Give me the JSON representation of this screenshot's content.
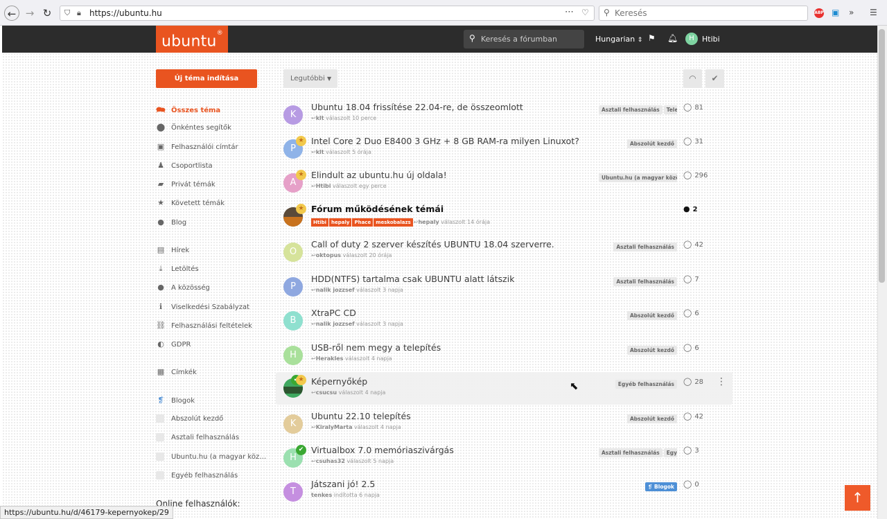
{
  "browser": {
    "url": "https://ubuntu.hu",
    "search_placeholder": "Keresés",
    "status_url": "https://ubuntu.hu/d/46179-kepernyokep/29"
  },
  "header": {
    "logo_text": "ubuntu",
    "logo_mark": "®",
    "search_placeholder": "Keresés a fórumban",
    "language": "Hungarian",
    "username": "Htibi",
    "avatar_letter": "H"
  },
  "sidebar": {
    "new_topic": "Új téma indítása",
    "items": [
      {
        "label": "Összes téma",
        "icon": "💬"
      },
      {
        "label": "Önkéntes segítők",
        "icon": "📍"
      },
      {
        "label": "Felhasználói címtár",
        "icon": "▣"
      },
      {
        "label": "Csoportlista",
        "icon": "👥"
      },
      {
        "label": "Privát témák",
        "icon": "🗨"
      },
      {
        "label": "Követett témák",
        "icon": "★"
      },
      {
        "label": "Blog",
        "icon": "●"
      },
      {
        "label": "Hírek",
        "icon": "▤"
      },
      {
        "label": "Letöltés",
        "icon": "⤓"
      },
      {
        "label": "A közösség",
        "icon": "●"
      },
      {
        "label": "Viselkedési Szabályzat",
        "icon": "ℹ"
      },
      {
        "label": "Felhasználási feltételek",
        "icon": "🔗"
      },
      {
        "label": "GDPR",
        "icon": "◐"
      },
      {
        "label": "Címkék",
        "icon": "▦"
      },
      {
        "label": "Blogok",
        "icon": "❡"
      },
      {
        "label": "Abszolút kezdő",
        "icon": ""
      },
      {
        "label": "Asztali felhasználás",
        "icon": ""
      },
      {
        "label": "Ubuntu.hu (a magyar köz…",
        "icon": ""
      },
      {
        "label": "Egyéb felhasználás",
        "icon": ""
      }
    ],
    "online_label": "Online felhasználók:"
  },
  "toolbar": {
    "sort_label": "Legutóbbi"
  },
  "topics": [
    {
      "title": "Ubuntu 18.04 frissítése 22.04-re, de összeomlott",
      "user": "klt",
      "meta": "válaszolt 10 perce",
      "tags": [
        "Asztali felhasználás",
        "Telepít"
      ],
      "count": "81",
      "avatar": "K",
      "color": "#b79be3"
    },
    {
      "title": "Intel Core 2 Duo E8400 3 GHz + 8 GB RAM-ra milyen Linuxot?",
      "user": "klt",
      "meta": "válaszolt 5 órája",
      "tags": [
        "Abszolút kezdő"
      ],
      "count": "31",
      "avatar": "P",
      "color": "#8fb3e8"
    },
    {
      "title": "Elindult az ubuntu.hu új oldala!",
      "user": "Htibi",
      "meta": "válaszolt egy perce",
      "tags": [
        "Ubuntu.hu (a magyar közösség"
      ],
      "count": "296",
      "avatar": "A",
      "color": "#e6a0c8"
    },
    {
      "title": "Fórum működésének témái",
      "user": "hepaly",
      "meta": "válaszolt 14 órája",
      "user_tags": [
        "Htibi",
        "hepaly",
        "Phace",
        "meskobalazs"
      ],
      "tags": [],
      "count": "2",
      "avatar": "",
      "color": "#5a4a3a"
    },
    {
      "title": "Call of duty 2 szerver készítés UBUNTU 18.04 szerverre.",
      "user": "oktopus",
      "meta": "válaszolt 20 órája",
      "tags": [
        "Asztali felhasználás"
      ],
      "count": "42",
      "avatar": "O",
      "color": "#d6e39b"
    },
    {
      "title": "HDD(NTFS) tartalma csak UBUNTU alatt látszik",
      "user": "nalik jozzsef",
      "meta": "válaszolt 3 napja",
      "tags": [
        "Asztali felhasználás"
      ],
      "count": "7",
      "avatar": "P",
      "color": "#8fa8e0"
    },
    {
      "title": "XtraPC CD",
      "user": "nalik jozzsef",
      "meta": "válaszolt 3 napja",
      "tags": [
        "Abszolút kezdő"
      ],
      "count": "6",
      "avatar": "B",
      "color": "#8fe0cf"
    },
    {
      "title": "USB-ről nem megy a telepítés",
      "user": "Herakles",
      "meta": "válaszolt 4 napja",
      "tags": [
        "Abszolút kezdő"
      ],
      "count": "6",
      "avatar": "H",
      "color": "#a9e09b"
    },
    {
      "title": "Képernyőkép",
      "user": "csucsu",
      "meta": "válaszolt 4 napja",
      "tags": [
        "Egyéb felhasználás"
      ],
      "count": "28",
      "avatar": "",
      "color": "#3fa860"
    },
    {
      "title": "Ubuntu 22.10 telepítés",
      "user": "KiralyMarta",
      "meta": "válaszolt 4 napja",
      "tags": [
        "Abszolút kezdő"
      ],
      "count": "42",
      "avatar": "K",
      "color": "#e3cc9b"
    },
    {
      "title": "Virtualbox 7.0 memóriaszivárgás",
      "user": "csuhas32",
      "meta": "válaszolt 5 napja",
      "tags": [
        "Asztali felhasználás",
        "Egyéb f"
      ],
      "count": "3",
      "avatar": "H",
      "color": "#9be0b0"
    },
    {
      "title": "Játszani jó! 2.5",
      "user": "tenkes",
      "meta": "indította 6 napja",
      "tags": [
        "Blogok"
      ],
      "count": "0",
      "avatar": "T",
      "color": "#c58fe0"
    }
  ]
}
